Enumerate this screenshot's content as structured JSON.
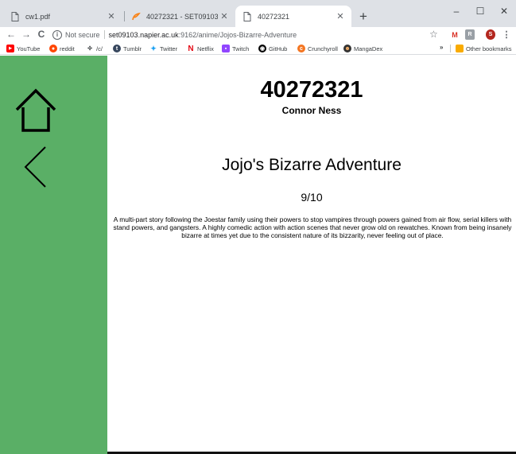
{
  "browser": {
    "tabs": [
      {
        "title": "cw1.pdf",
        "icon": "document-icon",
        "active": false
      },
      {
        "title": "40272321 - SET09103 Coursewo",
        "icon": "moodle-icon",
        "active": false
      },
      {
        "title": "40272321",
        "icon": "document-icon",
        "active": true
      }
    ],
    "new_tab": "+",
    "window_controls": {
      "minimize": "–",
      "maximize": "☐",
      "close": "✕"
    },
    "nav": {
      "back": "←",
      "forward": "→",
      "reload": "C"
    },
    "address": {
      "security_label": "Not secure",
      "host": "set09103.napier.ac.uk",
      "path": ":9162/anime/Jojos-Bizarre-Adventure"
    },
    "extensions": [
      "M",
      "R",
      "S",
      "⋮"
    ],
    "bookmarks": [
      {
        "label": "YouTube",
        "icon": "youtube-icon",
        "color": "#ff0000"
      },
      {
        "label": "reddit",
        "icon": "reddit-icon",
        "color": "#ff4500"
      },
      {
        "label": "/c/",
        "icon": "grid-icon",
        "color": "#3c4043"
      },
      {
        "label": "Tumblr",
        "icon": "tumblr-icon",
        "color": "#36465d"
      },
      {
        "label": "Twitter",
        "icon": "twitter-icon",
        "color": "#1da1f2"
      },
      {
        "label": "Netflix",
        "icon": "netflix-icon",
        "color": "#e50914"
      },
      {
        "label": "Twitch",
        "icon": "twitch-icon",
        "color": "#9146ff"
      },
      {
        "label": "GitHub",
        "icon": "github-icon",
        "color": "#000000"
      },
      {
        "label": "Crunchyroll",
        "icon": "crunchyroll-icon",
        "color": "#f47521"
      },
      {
        "label": "MangaDex",
        "icon": "mangadex-icon",
        "color": "#333333"
      }
    ],
    "bookmarks_more": "»",
    "other_bookmarks": "Other bookmarks"
  },
  "page": {
    "student_id": "40272321",
    "student_name": "Connor Ness",
    "anime_title": "Jojo's Bizarre Adventure",
    "rating": "9/10",
    "description": "A multi-part story following the Joestar family using their powers to stop vampires through powers gained from air flow, serial killers with stand powers, and gangsters. A highly comedic action with action scenes that never grow old on rewatches. Known from being insanely bizarre at times yet due to the consistent nature of its bizzarity, never feeling out of place.",
    "sidebar_color": "#5aaf66",
    "sidebar_icons": [
      "home-icon",
      "back-icon"
    ]
  }
}
